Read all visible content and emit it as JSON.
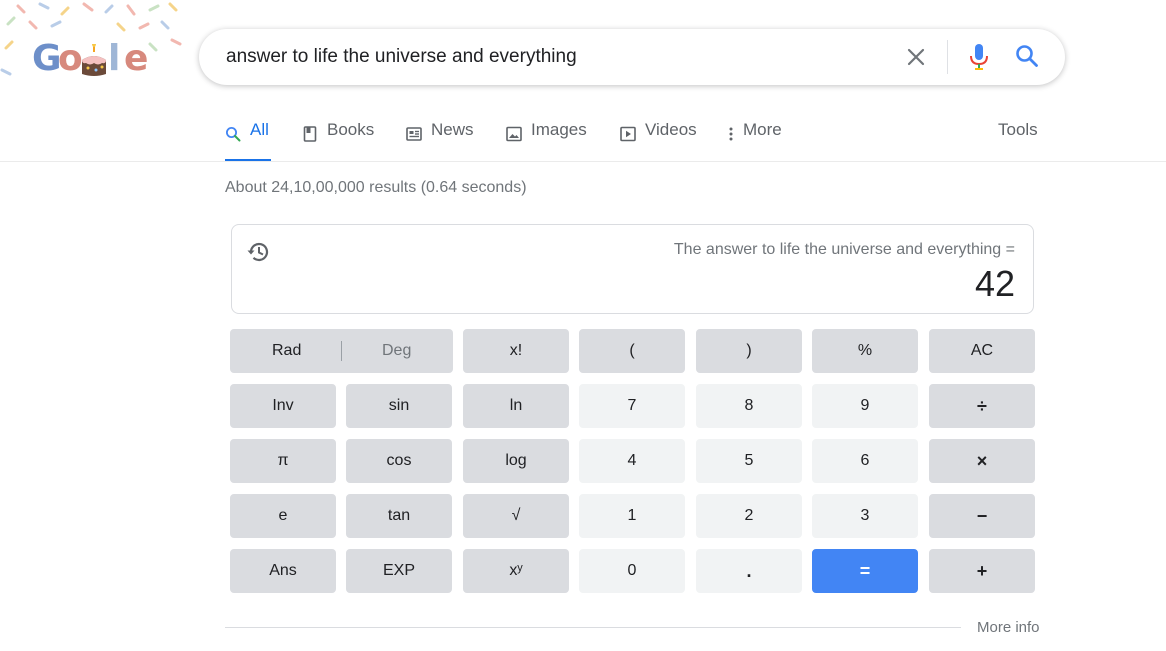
{
  "search": {
    "query": "answer to life the universe and everything"
  },
  "tabs": [
    {
      "label": "All",
      "icon": "search-icon"
    },
    {
      "label": "Books",
      "icon": "book-icon"
    },
    {
      "label": "News",
      "icon": "newspaper-icon"
    },
    {
      "label": "Images",
      "icon": "image-icon"
    },
    {
      "label": "Videos",
      "icon": "play-icon"
    },
    {
      "label": "More",
      "icon": "more-vertical-icon"
    }
  ],
  "tools_label": "Tools",
  "stats": "About 24,10,00,000 results (0.64 seconds)",
  "calculator": {
    "expression": "The answer to life the universe and everything =",
    "result": "42",
    "keys": {
      "rad": "Rad",
      "deg": "Deg",
      "fact": "x!",
      "lparen": "(",
      "rparen": ")",
      "percent": "%",
      "ac": "AC",
      "inv": "Inv",
      "sin": "sin",
      "ln": "ln",
      "k7": "7",
      "k8": "8",
      "k9": "9",
      "divide": "÷",
      "pi": "π",
      "cos": "cos",
      "log": "log",
      "k4": "4",
      "k5": "5",
      "k6": "6",
      "multiply": "×",
      "e": "e",
      "tan": "tan",
      "sqrt": "√",
      "k1": "1",
      "k2": "2",
      "k3": "3",
      "minus": "−",
      "ans": "Ans",
      "exp": "EXP",
      "pow": "xʸ",
      "k0": "0",
      "dot": ".",
      "equals": "=",
      "plus": "+"
    }
  },
  "more_info": "More info",
  "colors": {
    "accent": "#1a73e8",
    "equals_key": "#4285f4",
    "op_key": "#dadce0",
    "num_key": "#f1f3f4"
  }
}
